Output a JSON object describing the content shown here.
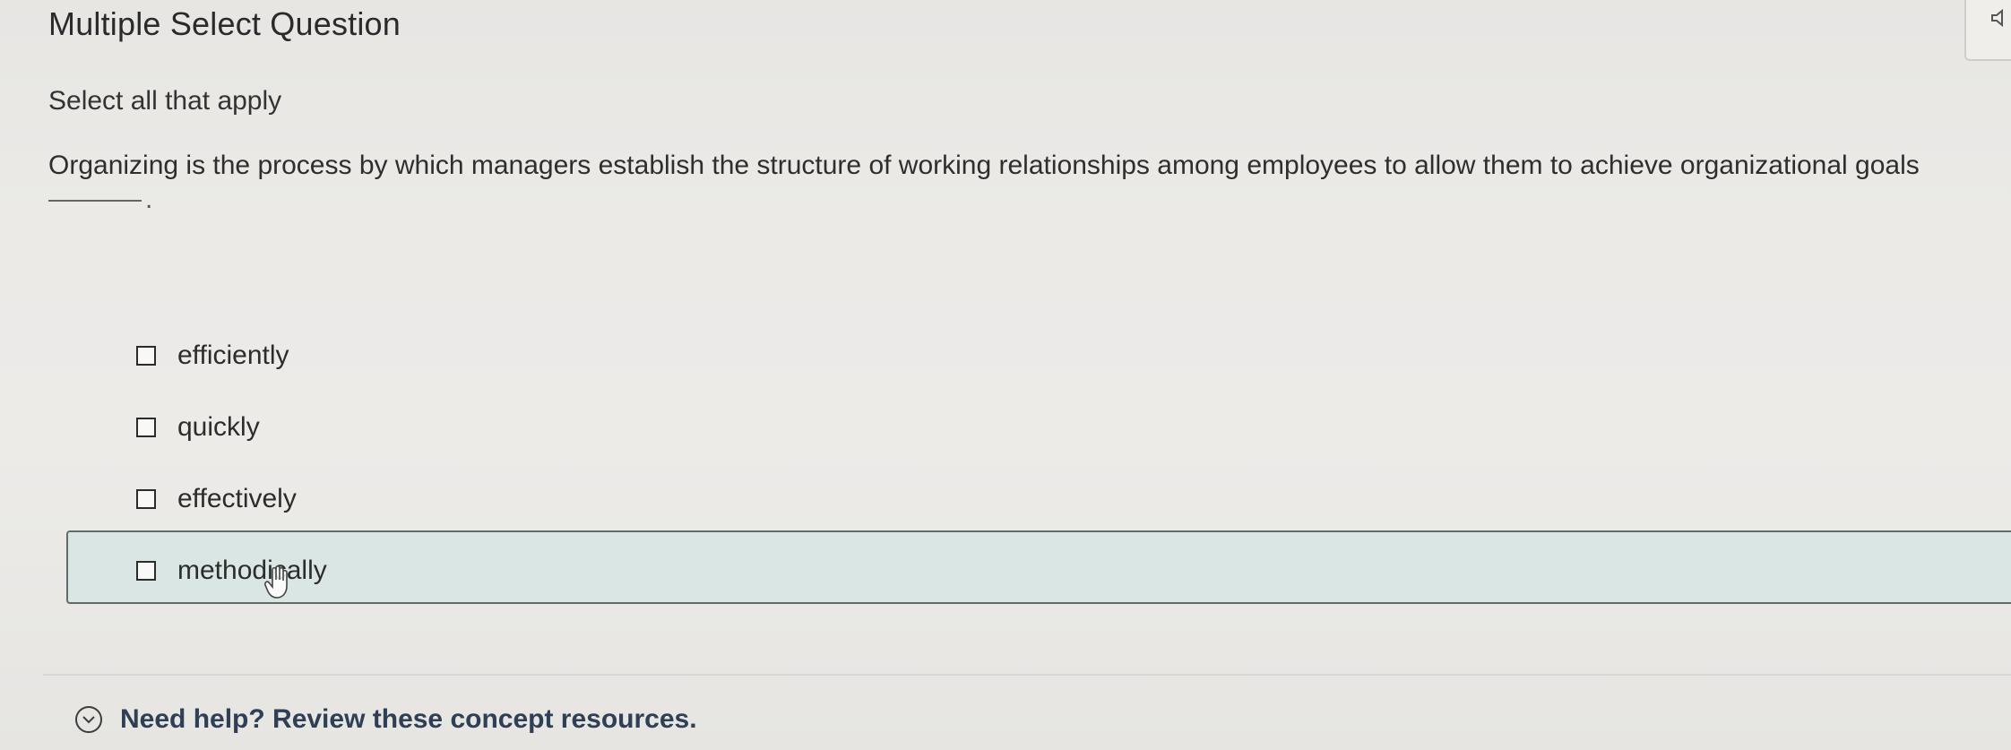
{
  "header": {
    "title": "Multiple Select Question",
    "speaker_icon": "speaker-icon"
  },
  "question": {
    "instruction": "Select all that apply",
    "prompt": "Organizing is the process by which managers establish the structure of working relationships among employees to allow them to achieve organizational goals",
    "blank_suffix": "."
  },
  "options": [
    {
      "label": "efficiently",
      "checked": false,
      "hovered": false
    },
    {
      "label": "quickly",
      "checked": false,
      "hovered": false
    },
    {
      "label": "effectively",
      "checked": false,
      "hovered": false
    },
    {
      "label": "methodically",
      "checked": false,
      "hovered": true
    }
  ],
  "help": {
    "label": "Need help? Review these concept resources.",
    "icon": "chevron-down-circle-icon"
  },
  "colors": {
    "hover_background": "#d9e6e3",
    "hover_border": "#5f6d6a",
    "help_text": "#2f3f55"
  }
}
